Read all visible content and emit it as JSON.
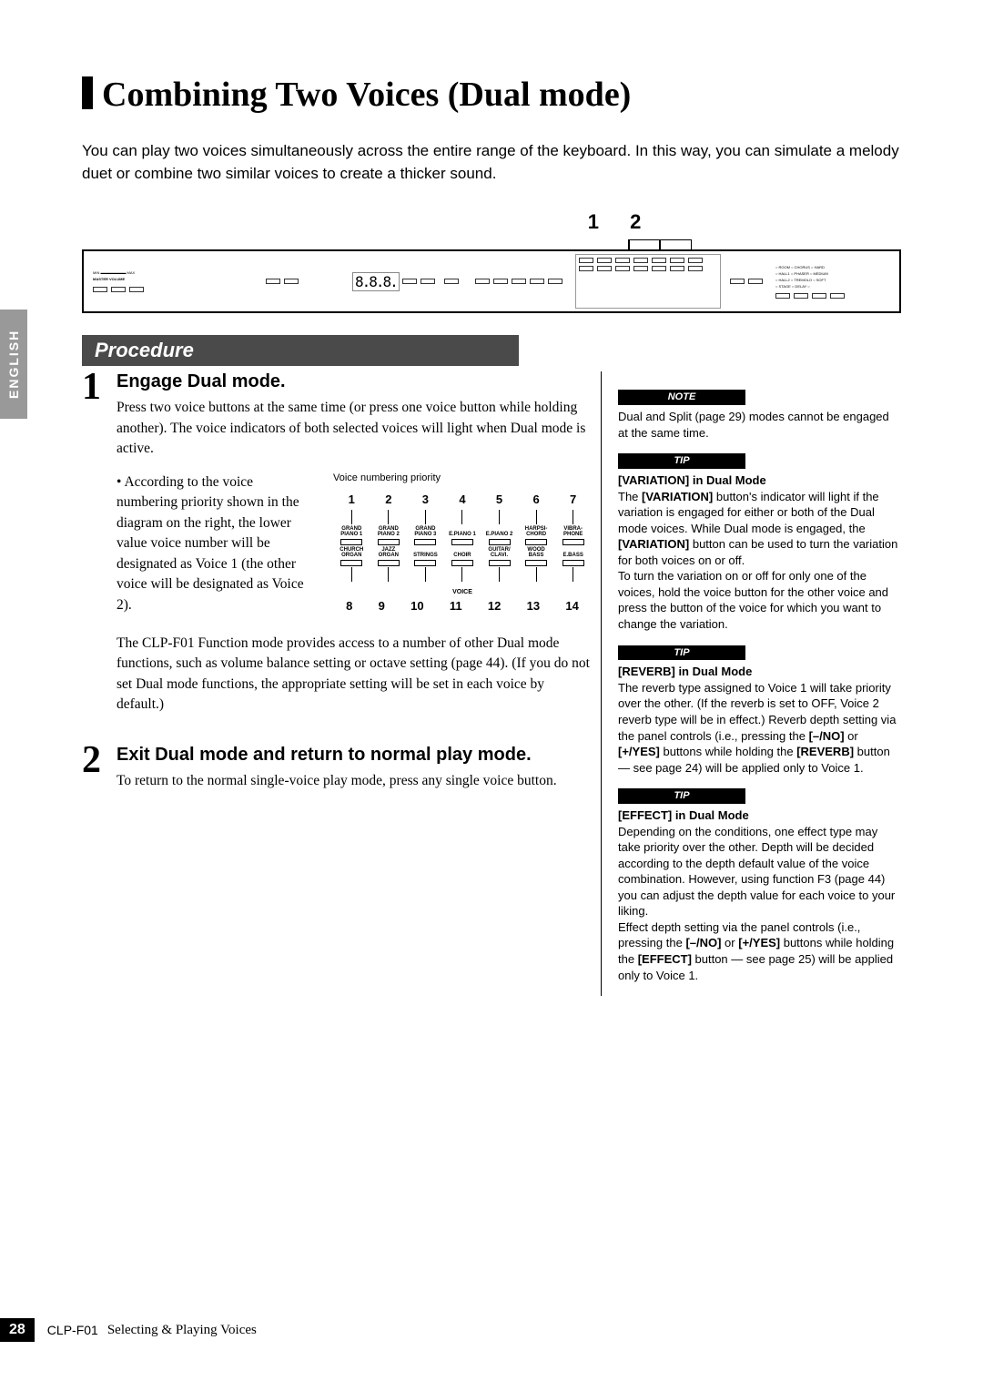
{
  "title": "Combining Two Voices (Dual mode)",
  "intro": "You can play two voices simultaneously across the entire range of the keyboard. In this way, you can simulate a melody duet or combine two similar voices to create a thicker sound.",
  "callouts": [
    "1",
    "2"
  ],
  "panel_display": "8.8.8.",
  "english_tab": "ENGLISH",
  "procedure_heading": "Procedure",
  "steps": [
    {
      "num": "1",
      "title": "Engage Dual mode.",
      "text": "Press two voice buttons at the same time (or press one voice button while holding another). The voice indicators of both selected voices will light when Dual mode is active.",
      "bullet": "According to the voice numbering priority shown in the diagram on the right, the lower value voice number will be designated as Voice 1 (the other voice will be designated as Voice 2).",
      "after": "The CLP-F01 Function mode provides access to a number of other Dual mode functions, such as volume balance setting or octave setting (page 44). (If you do not set Dual mode functions, the appropriate setting will be set in each voice by default.)"
    },
    {
      "num": "2",
      "title": "Exit Dual mode and return to normal play mode.",
      "text": "To return to the normal single-voice play mode, press any single voice button."
    }
  ],
  "voice_diagram": {
    "title": "Voice numbering priority",
    "top_nums": [
      "1",
      "2",
      "3",
      "4",
      "5",
      "6",
      "7"
    ],
    "row1": [
      "GRAND PIANO 1",
      "GRAND PIANO 2",
      "GRAND PIANO 3",
      "E.PIANO 1",
      "E.PIANO 2",
      "HARPSI-CHORD",
      "VIBRA-PHONE"
    ],
    "row2": [
      "CHURCH ORGAN",
      "JAZZ ORGAN",
      "STRINGS",
      "CHOIR",
      "GUITAR/ CLAVI.",
      "WOOD BASS",
      "E.BASS"
    ],
    "bot_nums": [
      "8",
      "9",
      "10",
      "11",
      "12",
      "13",
      "14"
    ],
    "voice_label": "VOICE"
  },
  "sidebar": [
    {
      "label": "NOTE",
      "title": "",
      "text": "Dual and Split (page 29) modes cannot be engaged at the same time."
    },
    {
      "label": "TIP",
      "title": "[VARIATION] in Dual Mode",
      "text": "The [VARIATION] button's indicator will light if the variation is engaged for either or both of the Dual mode voices. While Dual mode is engaged, the [VARIATION] button can be used to turn the variation for both voices on or off.\nTo turn the variation on or off for only one of the voices, hold the voice button for the other voice and press the button of the voice for which you want to change the variation."
    },
    {
      "label": "TIP",
      "title": "[REVERB] in Dual Mode",
      "text": "The reverb type assigned to Voice 1 will take priority over the other. (If the reverb is set to OFF, Voice 2 reverb type will be in effect.) Reverb depth setting via the panel controls (i.e., pressing the [–/NO] or [+/YES] buttons while holding the [REVERB] button — see page 24) will be applied only to Voice 1."
    },
    {
      "label": "TIP",
      "title": "[EFFECT] in Dual Mode",
      "text": "Depending on the conditions, one effect type may take priority over the other. Depth will be decided according to the depth default value of the voice combination. However, using function F3 (page 44) you can adjust the depth value for each voice to your liking.\nEffect depth setting via the panel controls (i.e., pressing the [–/NO] or [+/YES] buttons while holding the [EFFECT] button — see page 25) will be applied only to Voice 1."
    }
  ],
  "footer": {
    "page": "28",
    "model": "CLP-F01",
    "section": "Selecting & Playing Voices"
  }
}
